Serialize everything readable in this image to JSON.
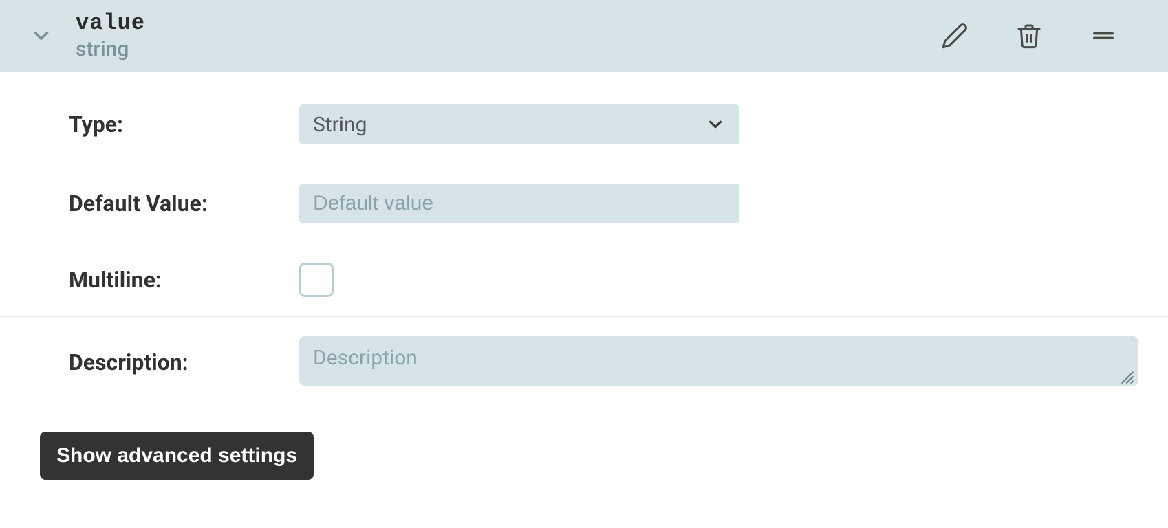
{
  "header": {
    "name": "value",
    "datatype": "string"
  },
  "form": {
    "type_label": "Type:",
    "type_value": "String",
    "default_label": "Default Value:",
    "default_placeholder": "Default value",
    "default_value": "",
    "multiline_label": "Multiline:",
    "multiline_checked": false,
    "description_label": "Description:",
    "description_placeholder": "Description",
    "description_value": ""
  },
  "buttons": {
    "advanced": "Show advanced settings"
  }
}
